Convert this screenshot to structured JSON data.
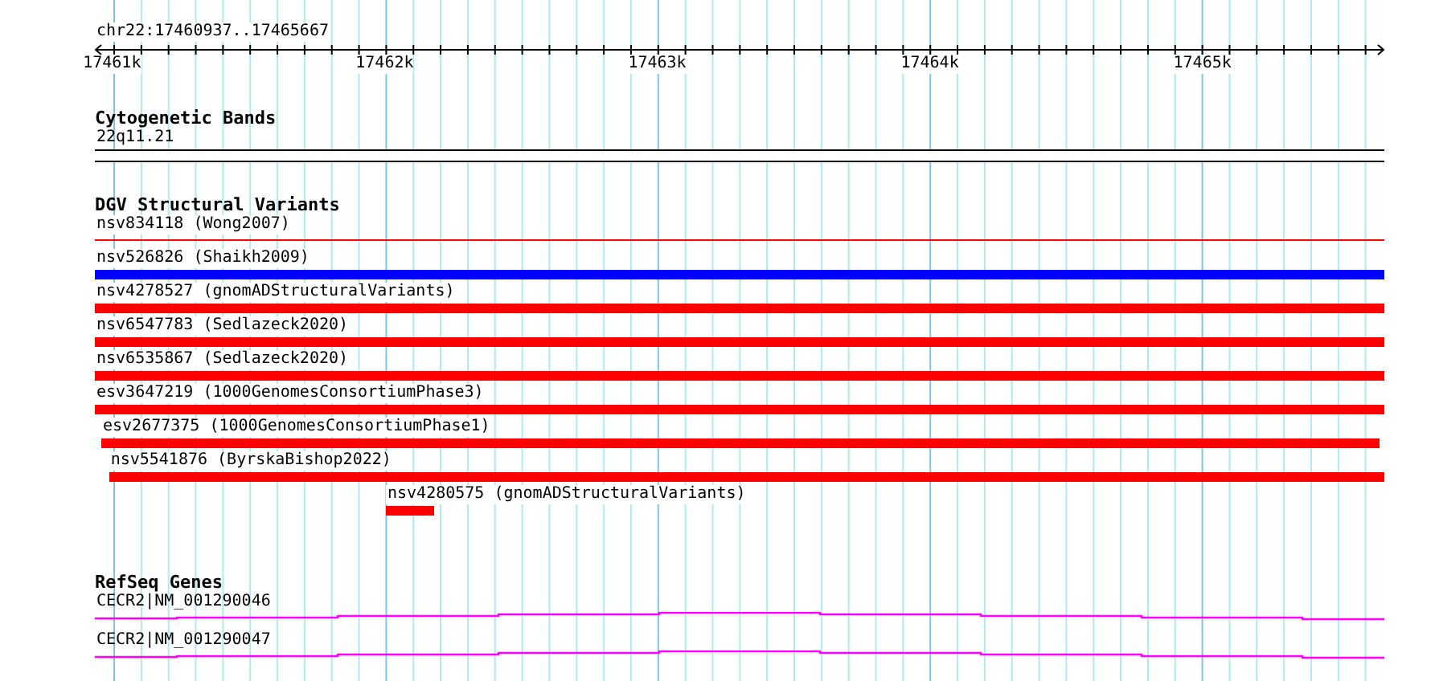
{
  "region": "chr22:17460937..17465667",
  "ruler_ticks": [
    {
      "label": "17461k"
    },
    {
      "label": "17462k"
    },
    {
      "label": "17463k"
    },
    {
      "label": "17464k"
    },
    {
      "label": "17465k"
    }
  ],
  "cytogenetic_bands": {
    "title": "Cytogenetic Bands",
    "band": "22q11.21"
  },
  "dgv_structural_variants": {
    "title": "DGV Structural Variants",
    "variants": [
      {
        "label": "nsv834118 (Wong2007)",
        "kind": "line",
        "color": "#ff0000"
      },
      {
        "label": "nsv526826 (Shaikh2009)",
        "kind": "bar",
        "color": "#0000ff"
      },
      {
        "label": "nsv4278527 (gnomADStructuralVariants)",
        "kind": "bar",
        "color": "#ff0000"
      },
      {
        "label": "nsv6547783 (Sedlazeck2020)",
        "kind": "bar",
        "color": "#ff0000"
      },
      {
        "label": "nsv6535867 (Sedlazeck2020)",
        "kind": "bar",
        "color": "#ff0000"
      },
      {
        "label": "esv3647219 (1000GenomesConsortiumPhase3)",
        "kind": "bar",
        "color": "#ff0000"
      },
      {
        "label": "esv2677375 (1000GenomesConsortiumPhase1)",
        "kind": "bar",
        "color": "#ff0000"
      },
      {
        "label": "nsv5541876 (ByrskaBishop2022)",
        "kind": "bar",
        "color": "#ff0000"
      },
      {
        "label": "nsv4280575 (gnomADStructuralVariants)",
        "kind": "bar",
        "color": "#ff0000"
      }
    ]
  },
  "refseq_genes": {
    "title": "RefSeq Genes",
    "transcripts": [
      {
        "label": "CECR2|NM_001290046"
      },
      {
        "label": "CECR2|NM_001290047"
      }
    ]
  }
}
